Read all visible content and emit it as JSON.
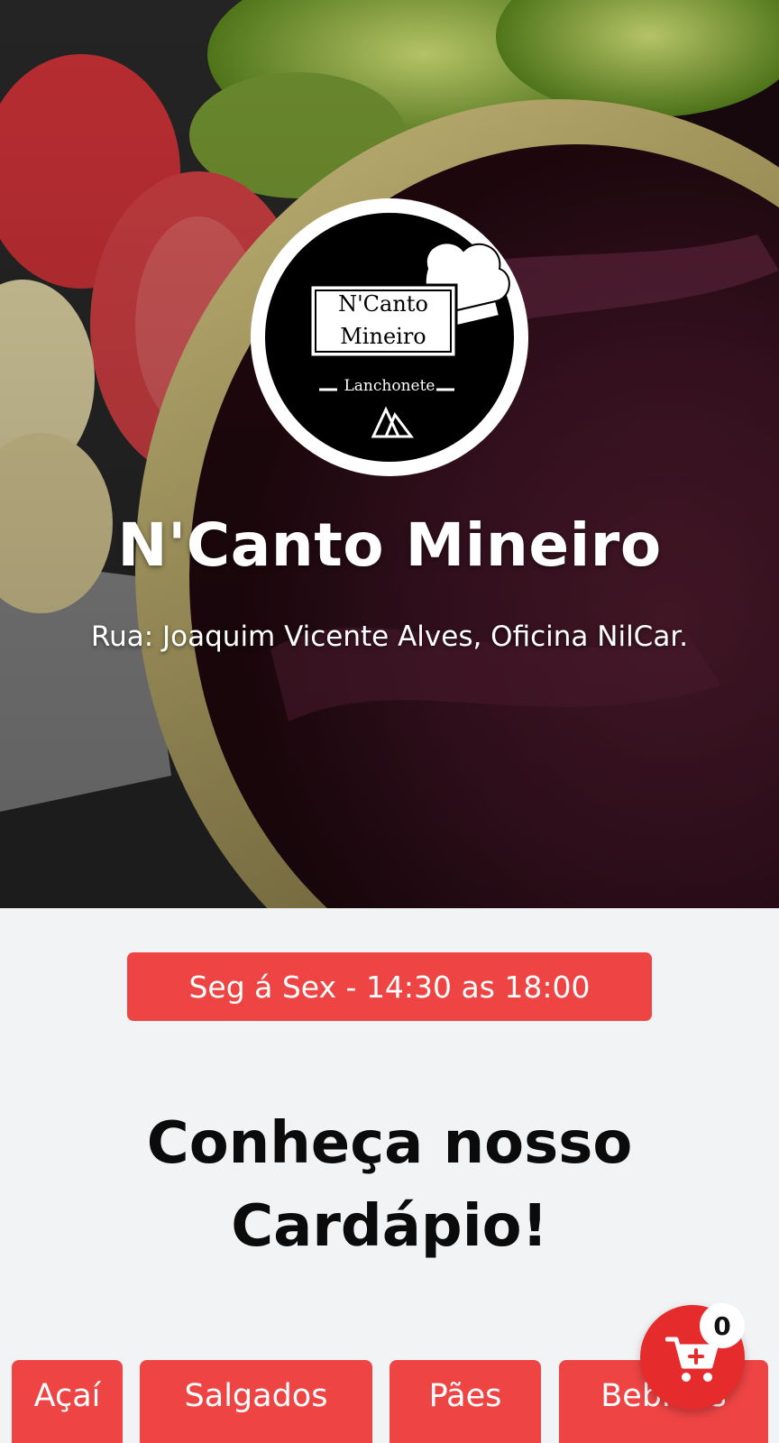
{
  "store": {
    "logo": {
      "name_line1": "N'Canto",
      "name_line2": "Mineiro",
      "subtitle": "Lanchonete"
    },
    "title": "N'Canto Mineiro",
    "address": "Rua: Joaquim Vicente Alves, Oficina NilCar."
  },
  "hours_label": "Seg á Sex - 14:30 as 18:00",
  "menu_heading": {
    "line1": "Conheça nosso",
    "line2": "Cardápio!"
  },
  "categories": [
    {
      "label": "Açaí"
    },
    {
      "label": "Salgados"
    },
    {
      "label": "Pães"
    },
    {
      "label": "Bebidas"
    }
  ],
  "cart": {
    "icon": "cart-icon",
    "count": "0"
  },
  "colors": {
    "accent": "#ef4444",
    "page_background": "#f2f3f5"
  }
}
